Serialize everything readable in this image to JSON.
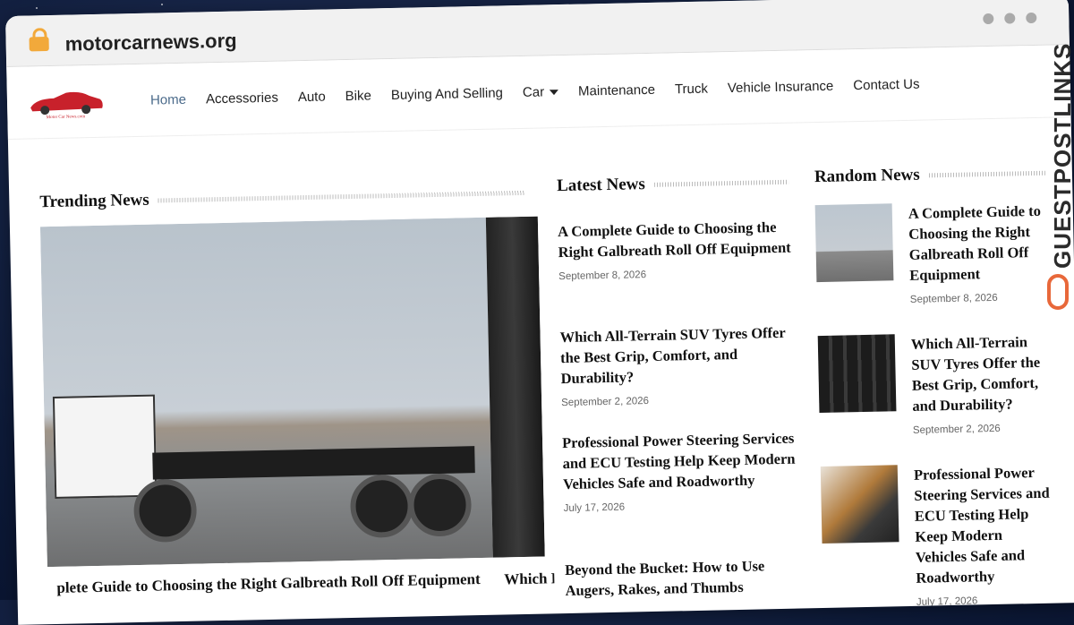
{
  "browser": {
    "url": "motorcarnews.org"
  },
  "site": {
    "logo_text": "Motor Car News.com",
    "nav": [
      {
        "label": "Home",
        "active": true
      },
      {
        "label": "Accessories"
      },
      {
        "label": "Auto"
      },
      {
        "label": "Bike"
      },
      {
        "label": "Buying And Selling"
      },
      {
        "label": "Car",
        "dropdown": true
      },
      {
        "label": "Maintenance"
      },
      {
        "label": "Truck"
      },
      {
        "label": "Vehicle Insurance"
      },
      {
        "label": "Contact Us"
      }
    ]
  },
  "trending": {
    "title": "Trending News",
    "caption_main": "plete Guide to Choosing the Right Galbreath Roll Off Equipment",
    "caption_side": "Which Durabi"
  },
  "latest": {
    "title": "Latest News",
    "posts": [
      {
        "title": "A Complete Guide to Choosing the Right Galbreath Roll Off Equipment",
        "date": "September 8, 2026"
      },
      {
        "title": "Which All-Terrain SUV Tyres Offer the Best Grip, Comfort, and Durability?",
        "date": "September 2, 2026"
      },
      {
        "title": "Professional Power Steering Services and ECU Testing Help Keep Modern Vehicles Safe and Roadworthy",
        "date": "July 17, 2026"
      },
      {
        "title": "Beyond the Bucket: How to Use Augers, Rakes, and Thumbs",
        "date": ""
      }
    ]
  },
  "random": {
    "title": "Random News",
    "posts": [
      {
        "title": "A Complete Guide to Choosing the Right Galbreath Roll Off Equipment",
        "date": "September 8, 2026",
        "thumb": "truck"
      },
      {
        "title": "Which All-Terrain SUV Tyres Offer the Best Grip, Comfort, and Durability?",
        "date": "September 2, 2026",
        "thumb": "tyres"
      },
      {
        "title": "Professional Power Steering Services and ECU Testing Help Keep Modern Vehicles Safe and Roadworthy",
        "date": "July 17, 2026",
        "thumb": "engine"
      }
    ]
  },
  "watermark": {
    "text": "GUESTPOSTLINKS",
    "color": "#e8683a"
  }
}
